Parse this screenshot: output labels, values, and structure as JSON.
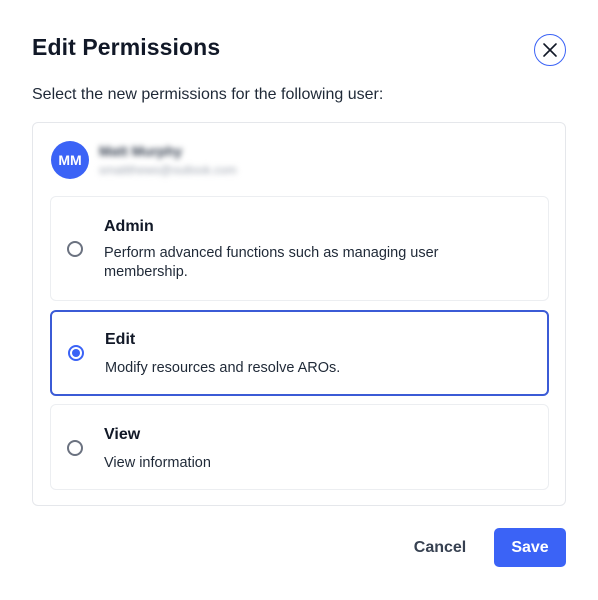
{
  "dialog": {
    "title": "Edit Permissions",
    "subtitle": "Select the new permissions for the following user:",
    "close_icon": "close-icon"
  },
  "user": {
    "initials": "MM",
    "name": "Matt Murphy",
    "email": "smattthews@outlook.com",
    "avatar_color": "#3b63f6"
  },
  "options": [
    {
      "title": "Admin",
      "description": "Perform advanced functions such as managing user membership.",
      "selected": false
    },
    {
      "title": "Edit",
      "description": "Modify resources and resolve AROs.",
      "selected": true
    },
    {
      "title": "View",
      "description": "View information",
      "selected": false
    }
  ],
  "footer": {
    "cancel_label": "Cancel",
    "save_label": "Save"
  },
  "colors": {
    "accent": "#3b63f6",
    "selected_border": "#3b5bd6"
  }
}
